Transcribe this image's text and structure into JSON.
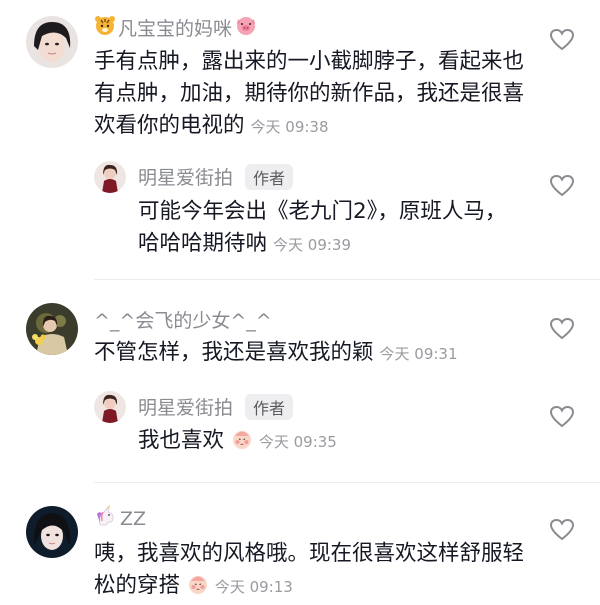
{
  "comments": [
    {
      "username": "凡宝宝的妈咪",
      "text": "手有点肿，露出来的一小截脚脖子，看起来也有点肿，加油，期待你的新作品，我还是很喜欢看你的电视的",
      "time": "今天 09:38",
      "reply": {
        "username": "明星爱街拍",
        "badge": "作者",
        "text": "可能今年会出《老九门2》，原班人马，哈哈哈期待呐",
        "time": "今天 09:39"
      }
    },
    {
      "username": "^_^会飞的少女^_^",
      "text": "不管怎样，我还是喜欢我的颖",
      "time": "今天 09:31",
      "reply": {
        "username": "明星爱街拍",
        "badge": "作者",
        "text": "我也喜欢",
        "time": "今天 09:35"
      }
    },
    {
      "username": "ZZ",
      "text": "咦，我喜欢的风格哦。现在很喜欢这样舒服轻松的穿搭",
      "time": "今天 09:13"
    }
  ],
  "colors": {
    "text": "#161823",
    "username": "#8a8b91",
    "time": "#9a9ba0",
    "badge_bg": "#eeeef0"
  },
  "icons": [
    "tiger-emoji-icon",
    "pig-emoji-icon",
    "heart-outline-icon",
    "unicorn-emoji-icon",
    "shy-face-emoji-icon"
  ]
}
